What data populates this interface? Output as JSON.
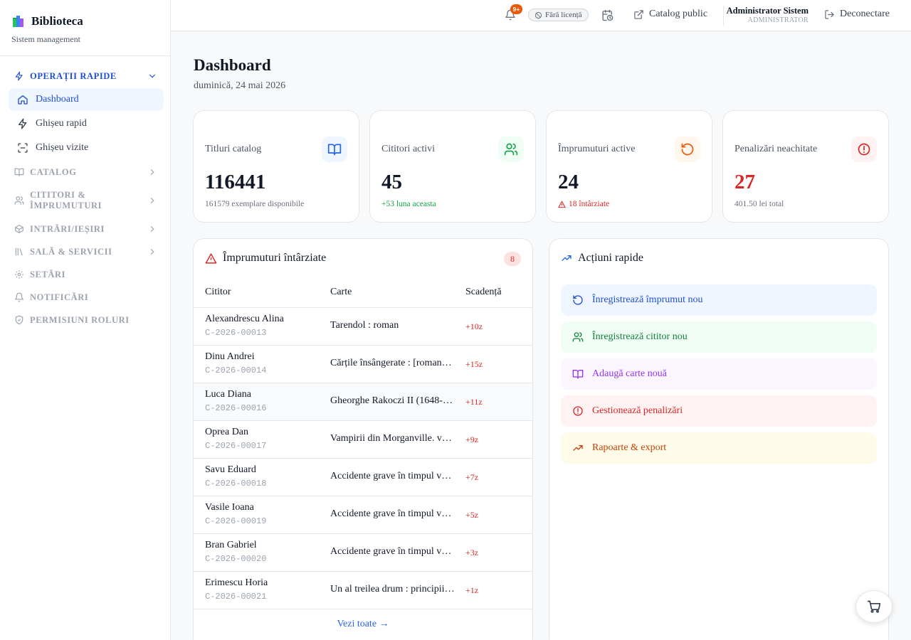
{
  "brand": {
    "title": "Biblioteca",
    "subtitle": "Sistem management"
  },
  "sidebar": {
    "quick_ops": {
      "label": "OPERAȚII RAPIDE",
      "items": [
        {
          "label": "Dashboard",
          "icon": "home-icon",
          "active": true
        },
        {
          "label": "Ghișeu rapid",
          "icon": "bolt-icon"
        },
        {
          "label": "Ghișeu vizite",
          "icon": "scan-icon"
        }
      ]
    },
    "sections": [
      {
        "label": "CATALOG",
        "icon": "book-open-icon"
      },
      {
        "label": "CITITORI & ÎMPRUMUTURI",
        "icon": "users-icon"
      },
      {
        "label": "INTRĂRI/IEȘIRI",
        "icon": "box-icon"
      },
      {
        "label": "SALĂ & SERVICII",
        "icon": "library-icon"
      },
      {
        "label": "SETĂRI",
        "icon": "gear-icon"
      },
      {
        "label": "NOTIFICĂRI",
        "icon": "bell-icon"
      },
      {
        "label": "PERMISIUNI ROLURI",
        "icon": "shield-icon"
      }
    ]
  },
  "topbar": {
    "notification_badge": "9+",
    "licence": "Fără licență",
    "catalog_public": "Catalog public",
    "user_name": "Administrator Sistem",
    "user_role": "ADMINISTRATOR",
    "logout": "Deconectare"
  },
  "page": {
    "title": "Dashboard",
    "date": "duminică, 24 mai 2026"
  },
  "stats": [
    {
      "label": "Titluri catalog",
      "value": "116441",
      "sub": "161579 exemplare disponibile",
      "icon": "book-open-icon",
      "accent": "#2563eb",
      "bg": "#eff6ff"
    },
    {
      "label": "Cititori activi",
      "value": "45",
      "sub": "+53 luna aceasta",
      "icon": "users-icon",
      "accent": "#16a34a",
      "bg": "#f0fdf4"
    },
    {
      "label": "Împrumuturi active",
      "value": "24",
      "sub": "18 întârziate",
      "icon": "rotate-icon",
      "accent": "#ea580c",
      "bg": "#fff7ed"
    },
    {
      "label": "Penalizări neachitate",
      "value": "27",
      "sub": "401.50 lei total",
      "icon": "alert-circle-icon",
      "accent": "#dc2626",
      "bg": "#fef2f2"
    }
  ],
  "overdue": {
    "title": "Împrumuturi întârziate",
    "count": "8",
    "columns": [
      "Cititor",
      "Carte",
      "Scadență"
    ],
    "rows": [
      {
        "name": "Alexandrescu Alina",
        "code": "C-2026-00013",
        "book": "Tarendol : roman",
        "due": "+10z"
      },
      {
        "name": "Dinu Andrei",
        "code": "C-2026-00014",
        "book": "Cărțile însângerate : [roman…",
        "due": "+15z"
      },
      {
        "name": "Luca Diana",
        "code": "C-2026-00016",
        "book": "Gheorghe Rakoczi II (1648-…",
        "due": "+11z"
      },
      {
        "name": "Oprea Dan",
        "code": "C-2026-00017",
        "book": "Vampirii din Morganville. v…",
        "due": "+9z"
      },
      {
        "name": "Savu Eduard",
        "code": "C-2026-00018",
        "book": "Accidente grave în timpul v…",
        "due": "+7z"
      },
      {
        "name": "Vasile Ioana",
        "code": "C-2026-00019",
        "book": "Accidente grave în timpul v…",
        "due": "+5z"
      },
      {
        "name": "Bran Gabriel",
        "code": "C-2026-00020",
        "book": "Accidente grave în timpul v…",
        "due": "+3z"
      },
      {
        "name": "Erimescu Horia",
        "code": "C-2026-00021",
        "book": "Un al treilea drum : principii…",
        "due": "+1z"
      }
    ],
    "see_all": "Vezi toate →"
  },
  "quick_actions": {
    "title": "Acțiuni rapide",
    "items": [
      {
        "label": "Înregistrează împrumut nou",
        "icon": "rotate-icon",
        "color": "#1d4ed8",
        "bg": "#eff6ff"
      },
      {
        "label": "Înregistrează cititor nou",
        "icon": "users-icon",
        "color": "#15803d",
        "bg": "#f0fdf4"
      },
      {
        "label": "Adaugă carte nouă",
        "icon": "book-open-icon",
        "color": "#9333ea",
        "bg": "#faf5ff"
      },
      {
        "label": "Gestionează penalizări",
        "icon": "alert-circle-icon",
        "color": "#dc2626",
        "bg": "#fef2f2"
      },
      {
        "label": "Rapoarte & export",
        "icon": "trending-up-icon",
        "color": "#c2410c",
        "bg": "#fefce8"
      }
    ]
  }
}
